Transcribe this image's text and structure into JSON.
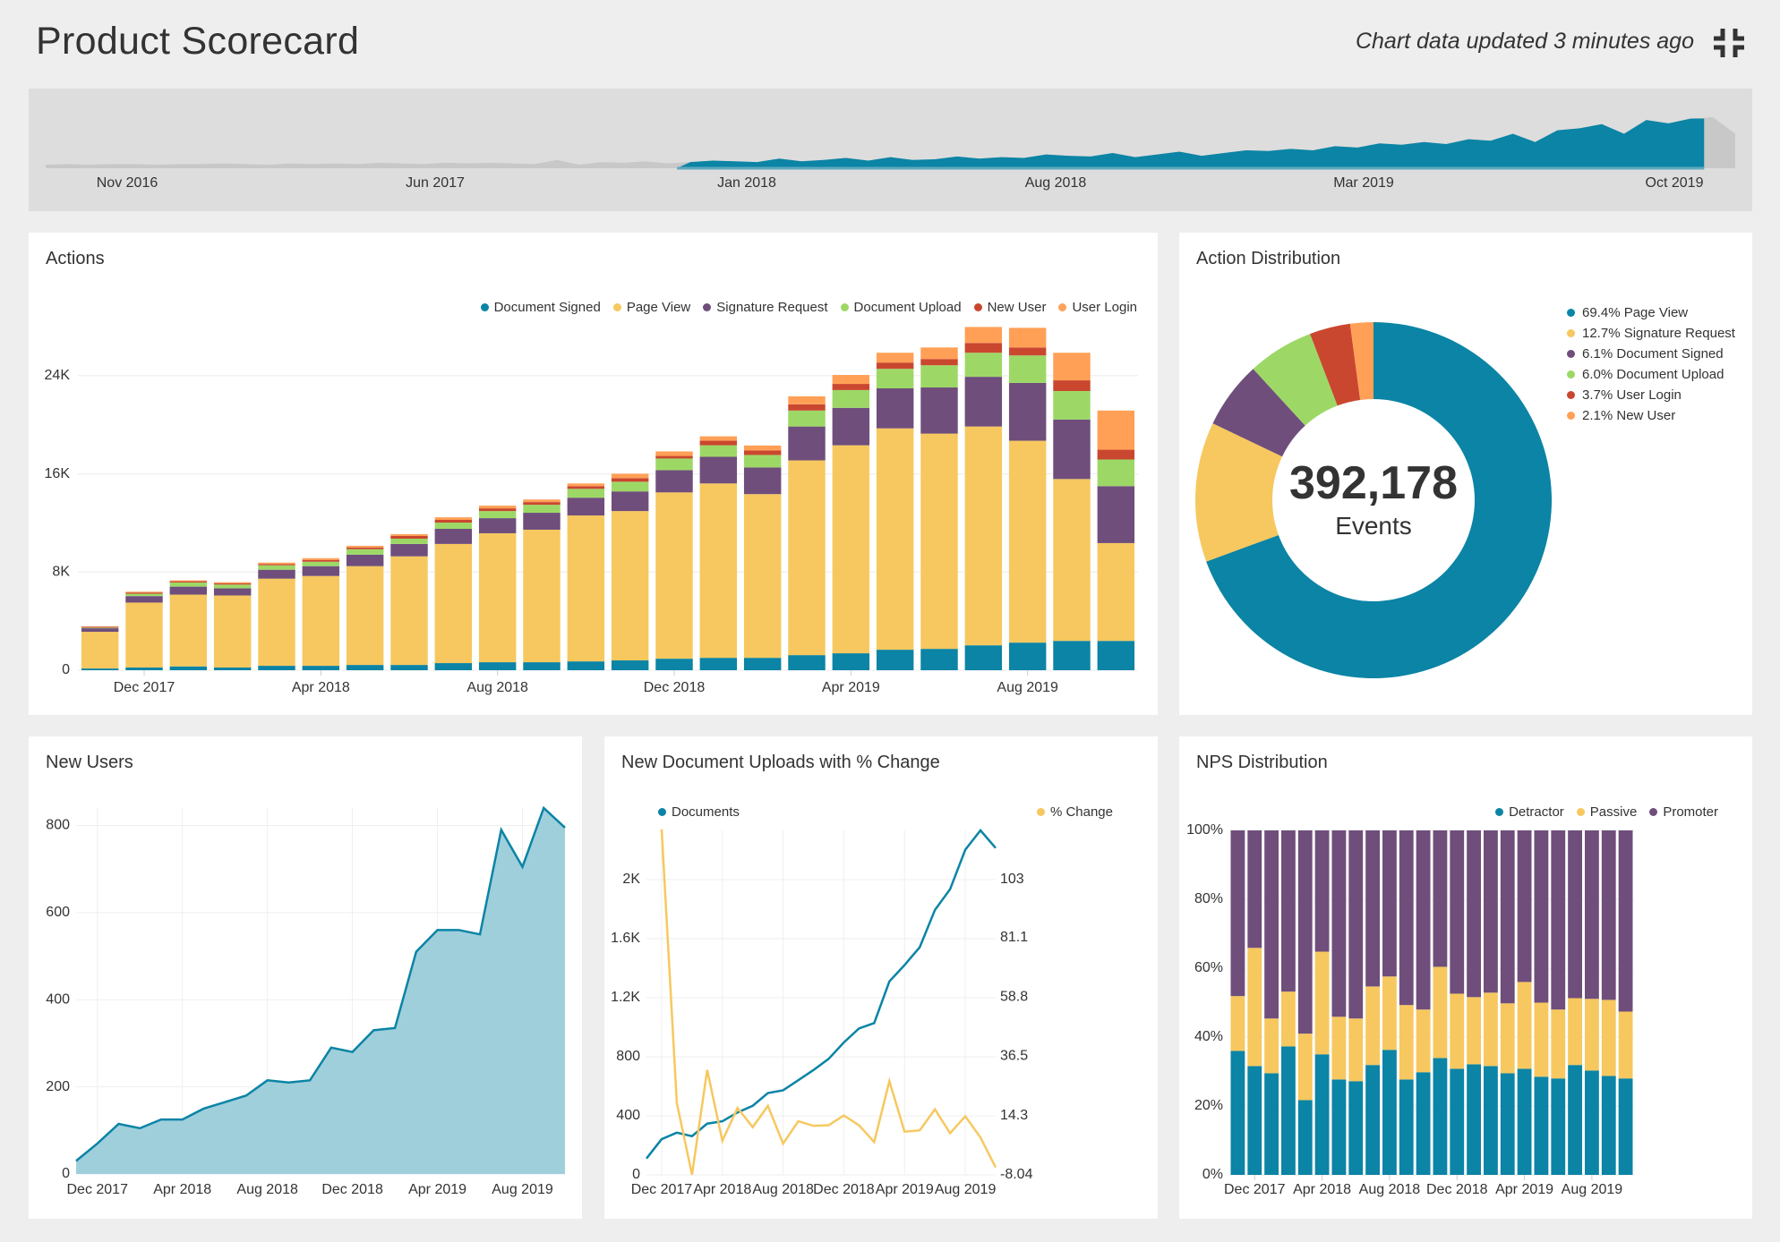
{
  "header": {
    "title": "Product Scorecard",
    "updated": "Chart data updated 3 minutes ago",
    "collapse_icon": "compress-icon"
  },
  "navigator": {
    "labels": [
      "Nov 2016",
      "Jun 2017",
      "Jan 2018",
      "Aug 2018",
      "Mar 2019",
      "Oct 2019"
    ],
    "values": [
      5,
      6,
      5,
      6,
      6,
      5,
      6,
      6,
      7,
      6,
      5,
      7,
      6,
      7,
      6,
      8,
      7,
      6,
      8,
      7,
      8,
      7,
      6,
      12,
      5,
      9,
      8,
      10,
      7,
      9,
      11,
      10,
      9,
      14,
      10,
      12,
      15,
      11,
      16,
      12,
      13,
      17,
      14,
      16,
      15,
      20,
      18,
      17,
      22,
      16,
      20,
      24,
      18,
      22,
      26,
      25,
      28,
      26,
      32,
      30,
      36,
      34,
      38,
      35,
      42,
      40,
      50,
      38,
      55,
      58,
      64,
      50,
      70,
      65,
      72,
      74,
      50
    ],
    "colors": {
      "selected": "#0b84a5",
      "unselected": "#c8c8c8",
      "background": "#dddddd"
    }
  },
  "actions": {
    "title": "Actions",
    "chart_data": {
      "type": "bar",
      "stacked": true,
      "categories": [
        "Nov 2017",
        "Dec 2017",
        "Jan 2018",
        "Feb 2018",
        "Mar 2018",
        "Apr 2018",
        "May 2018",
        "Jun 2018",
        "Jul 2018",
        "Aug 2018",
        "Sep 2018",
        "Oct 2018",
        "Nov 2018",
        "Dec 2018",
        "Jan 2019",
        "Feb 2019",
        "Mar 2019",
        "Apr 2019",
        "May 2019",
        "Jun 2019",
        "Jul 2019",
        "Aug 2019",
        "Sep 2019",
        "Oct 2019"
      ],
      "series": [
        {
          "name": "Document Signed",
          "color": "#0b84a5",
          "values": [
            140,
            220,
            310,
            220,
            360,
            360,
            430,
            430,
            580,
            650,
            650,
            720,
            800,
            940,
            1010,
            1010,
            1230,
            1380,
            1670,
            1740,
            2030,
            2250,
            2390,
            2390
          ]
        },
        {
          "name": "Page View",
          "color": "#f6c85f",
          "values": [
            2990,
            5290,
            5850,
            5870,
            7100,
            7320,
            8050,
            8850,
            9710,
            10510,
            10800,
            11890,
            12170,
            13550,
            14210,
            13340,
            15870,
            16950,
            18040,
            17540,
            17830,
            16450,
            13190,
            7970
          ]
        },
        {
          "name": "Signature Request",
          "color": "#6f4e7c",
          "values": [
            290,
            530,
            650,
            580,
            730,
            800,
            940,
            1010,
            1230,
            1230,
            1380,
            1450,
            1600,
            1810,
            2170,
            2170,
            2760,
            3050,
            3260,
            3760,
            4050,
            4710,
            4850,
            4640
          ]
        },
        {
          "name": "Document Upload",
          "color": "#9dd866",
          "values": [
            50,
            190,
            340,
            310,
            360,
            360,
            440,
            430,
            510,
            580,
            650,
            720,
            790,
            950,
            940,
            1020,
            1300,
            1450,
            1590,
            1810,
            1960,
            2240,
            2320,
            2170
          ]
        },
        {
          "name": "New User",
          "color": "#ca472f",
          "values": [
            80,
            100,
            100,
            100,
            100,
            150,
            140,
            220,
            220,
            220,
            220,
            220,
            290,
            210,
            370,
            360,
            510,
            500,
            510,
            510,
            800,
            650,
            870,
            800
          ]
        },
        {
          "name": "User Login",
          "color": "#ffa056",
          "values": [
            20,
            70,
            70,
            90,
            120,
            140,
            140,
            150,
            210,
            220,
            210,
            220,
            360,
            370,
            360,
            410,
            650,
            730,
            800,
            940,
            1300,
            1600,
            2250,
            3190
          ]
        }
      ],
      "yticks": [
        {
          "value": 0,
          "label": "0"
        },
        {
          "value": 8000,
          "label": "8K"
        },
        {
          "value": 16000,
          "label": "16K"
        },
        {
          "value": 24000,
          "label": "24K"
        }
      ],
      "xtick_labels": [
        "Dec 2017",
        "Apr 2018",
        "Aug 2018",
        "Dec 2018",
        "Apr 2019",
        "Aug 2019"
      ],
      "ylim": [
        0,
        28000
      ],
      "grid": true,
      "legend": "top-right"
    }
  },
  "distribution": {
    "title": "Action Distribution",
    "total": "392,178",
    "total_label": "Events",
    "chart_data": {
      "type": "pie",
      "donut": true,
      "slices": [
        {
          "label": "69.4% Page View",
          "value": 69.4,
          "color": "#0b84a5"
        },
        {
          "label": "12.7% Signature Request",
          "value": 12.7,
          "color": "#f6c85f"
        },
        {
          "label": "6.1% Document Signed",
          "value": 6.1,
          "color": "#6f4e7c"
        },
        {
          "label": "6.0% Document Upload",
          "value": 6.0,
          "color": "#9dd866"
        },
        {
          "label": "3.7% User Login",
          "value": 3.7,
          "color": "#ca472f"
        },
        {
          "label": "2.1% New User",
          "value": 2.1,
          "color": "#ffa056"
        }
      ],
      "legend": "right"
    }
  },
  "new_users": {
    "title": "New Users",
    "chart_data": {
      "type": "area",
      "categories": [
        "Nov 2017",
        "Dec 2017",
        "Jan 2018",
        "Feb 2018",
        "Mar 2018",
        "Apr 2018",
        "May 2018",
        "Jun 2018",
        "Jul 2018",
        "Aug 2018",
        "Sep 2018",
        "Oct 2018",
        "Nov 2018",
        "Dec 2018",
        "Jan 2019",
        "Feb 2019",
        "Mar 2019",
        "Apr 2019",
        "May 2019",
        "Jun 2019",
        "Jul 2019",
        "Aug 2019",
        "Sep 2019",
        "Oct 2019"
      ],
      "values": [
        30,
        70,
        115,
        105,
        125,
        125,
        150,
        165,
        180,
        215,
        210,
        215,
        290,
        280,
        330,
        335,
        510,
        560,
        560,
        550,
        790,
        705,
        840,
        795
      ],
      "color": "#0b84a5",
      "yticks": [
        {
          "value": 0,
          "label": "0"
        },
        {
          "value": 200,
          "label": "200"
        },
        {
          "value": 400,
          "label": "400"
        },
        {
          "value": 600,
          "label": "600"
        },
        {
          "value": 800,
          "label": "800"
        }
      ],
      "xtick_labels": [
        "Dec 2017",
        "Apr 2018",
        "Aug 2018",
        "Dec 2018",
        "Apr 2019",
        "Aug 2019"
      ],
      "ylim": [
        0,
        840
      ],
      "grid": true
    }
  },
  "uploads": {
    "title": "New Document Uploads with % Change",
    "chart_data": {
      "type": "line",
      "categories": [
        "Nov 2017",
        "Dec 2017",
        "Jan 2018",
        "Feb 2018",
        "Mar 2018",
        "Apr 2018",
        "May 2018",
        "Jun 2018",
        "Jul 2018",
        "Aug 2018",
        "Sep 2018",
        "Oct 2018",
        "Nov 2018",
        "Dec 2018",
        "Jan 2019",
        "Feb 2019",
        "Mar 2019",
        "Apr 2019",
        "May 2019",
        "Jun 2019",
        "Jul 2019",
        "Aug 2019",
        "Sep 2019",
        "Oct 2019"
      ],
      "series": [
        {
          "name": "Documents",
          "axis": "left",
          "color": "#0b84a5",
          "values": [
            111,
            242,
            286,
            262,
            347,
            363,
            423,
            468,
            554,
            573,
            641,
            710,
            786,
            897,
            992,
            1028,
            1310,
            1421,
            1542,
            1794,
            1935,
            2202,
            2333,
            2214
          ]
        },
        {
          "name": "% Change",
          "axis": "right",
          "color": "#f6c85f",
          "values": [
            null,
            121.8,
            19.0,
            -8.0,
            31.4,
            4.8,
            17.1,
            9.9,
            17.9,
            3.7,
            12.1,
            10.4,
            10.6,
            14.3,
            10.6,
            4.3,
            27.2,
            8.2,
            8.7,
            16.6,
            7.6,
            14.0,
            6.0,
            -5.2
          ]
        }
      ],
      "yticks_left": [
        {
          "value": 0,
          "label": "0"
        },
        {
          "value": 400,
          "label": "400"
        },
        {
          "value": 800,
          "label": "800"
        },
        {
          "value": 1200,
          "label": "1.2K"
        },
        {
          "value": 1600,
          "label": "1.6K"
        },
        {
          "value": 2000,
          "label": "2K"
        }
      ],
      "yticks_right": [
        {
          "value": -8.04,
          "label": "-8.04"
        },
        {
          "value": 14.3,
          "label": "14.3"
        },
        {
          "value": 36.5,
          "label": "36.5"
        },
        {
          "value": 58.8,
          "label": "58.8"
        },
        {
          "value": 81.1,
          "label": "81.1"
        },
        {
          "value": 103,
          "label": "103"
        }
      ],
      "xtick_labels": [
        "Dec 2017",
        "Apr 2018",
        "Aug 2018",
        "Dec 2018",
        "Apr 2019",
        "Aug 2019"
      ],
      "ylim_left": [
        0,
        2333
      ],
      "ylim_right": [
        -8.04,
        121.4
      ],
      "grid": true,
      "legend": "top"
    }
  },
  "nps": {
    "title": "NPS Distribution",
    "chart_data": {
      "type": "bar",
      "stacked": true,
      "percent": true,
      "categories": [
        "Nov 2017",
        "Dec 2017",
        "Jan 2018",
        "Feb 2018",
        "Mar 2018",
        "Apr 2018",
        "May 2018",
        "Jun 2018",
        "Jul 2018",
        "Aug 2018",
        "Sep 2018",
        "Oct 2018",
        "Nov 2018",
        "Dec 2018",
        "Jan 2019",
        "Feb 2019",
        "Mar 2019",
        "Apr 2019",
        "May 2019",
        "Jun 2019",
        "Jul 2019",
        "Aug 2019",
        "Sep 2019",
        "Oct 2019"
      ],
      "series": [
        {
          "name": "Detractor",
          "color": "#0b84a5",
          "values": [
            36.0,
            31.6,
            29.5,
            37.3,
            21.7,
            35.0,
            27.7,
            27.2,
            31.9,
            36.3,
            27.7,
            29.8,
            33.9,
            30.8,
            32.1,
            31.6,
            29.5,
            30.8,
            28.5,
            28.0,
            31.9,
            30.3,
            28.7,
            28.0
          ]
        },
        {
          "name": "Passive",
          "color": "#f6c85f",
          "values": [
            15.9,
            34.3,
            15.9,
            15.9,
            19.3,
            29.8,
            18.2,
            18.2,
            22.8,
            21.3,
            21.6,
            18.2,
            26.5,
            21.8,
            19.5,
            21.3,
            20.3,
            25.2,
            21.5,
            20.0,
            19.4,
            20.8,
            22.1,
            19.4
          ]
        },
        {
          "name": "Promoter",
          "color": "#6f4e7c",
          "values": [
            48.1,
            34.1,
            54.6,
            46.8,
            59.0,
            35.2,
            54.1,
            54.6,
            45.3,
            42.4,
            50.7,
            52.0,
            39.6,
            47.4,
            48.4,
            47.1,
            50.2,
            44.0,
            50.0,
            52.0,
            48.7,
            48.9,
            49.2,
            52.6
          ]
        }
      ],
      "yticks": [
        {
          "value": 0,
          "label": "0%"
        },
        {
          "value": 20,
          "label": "20%"
        },
        {
          "value": 40,
          "label": "40%"
        },
        {
          "value": 60,
          "label": "60%"
        },
        {
          "value": 80,
          "label": "80%"
        },
        {
          "value": 100,
          "label": "100%"
        }
      ],
      "xtick_labels": [
        "Dec 2017",
        "Apr 2018",
        "Aug 2018",
        "Dec 2018",
        "Apr 2019",
        "Aug 2019"
      ],
      "ylim": [
        0,
        100
      ],
      "grid": true,
      "legend": "top-right"
    }
  }
}
